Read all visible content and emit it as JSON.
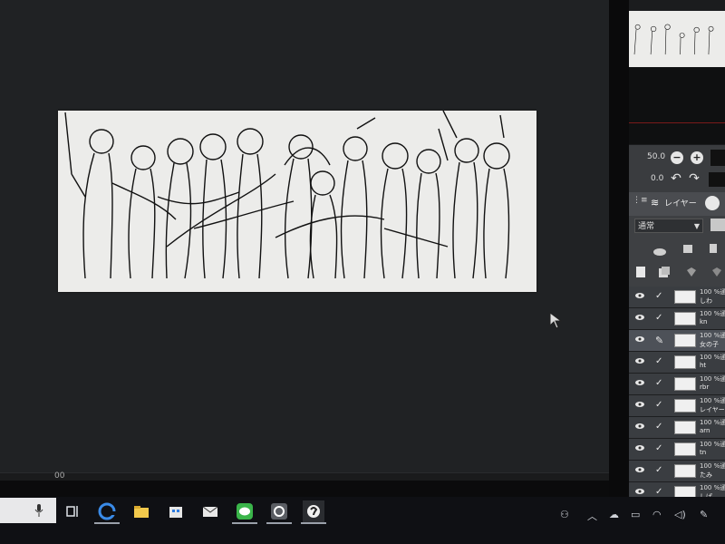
{
  "canvas": {
    "zoom_readout": "00"
  },
  "navigator": {
    "zoom_value": "50.0",
    "rotate_value": "0.0"
  },
  "layer_panel": {
    "tabs": [
      "レイヤー"
    ],
    "blend_mode": "通常",
    "layers": [
      {
        "opacity": "100 %通",
        "name": "しわ"
      },
      {
        "opacity": "100 %通",
        "name": "kn"
      },
      {
        "opacity": "100 %通",
        "name": "女の子"
      },
      {
        "opacity": "100 %通",
        "name": "ht"
      },
      {
        "opacity": "100 %通",
        "name": "rbr"
      },
      {
        "opacity": "100 %通",
        "name": "レイヤー"
      },
      {
        "opacity": "100 %通",
        "name": "arn"
      },
      {
        "opacity": "100 %通",
        "name": "tn"
      },
      {
        "opacity": "100 %通",
        "name": "たみ"
      },
      {
        "opacity": "100 %通",
        "name": "しぱ"
      }
    ]
  },
  "taskbar": {
    "apps": [
      "task-view",
      "edge",
      "file-explorer",
      "store",
      "mail",
      "line",
      "app-swirl",
      "clip-studio"
    ]
  },
  "colors": {
    "canvas_bg": "#202224",
    "paper": "#ececea",
    "panel": "#3a3d41",
    "taskbar": "#0f1014"
  }
}
